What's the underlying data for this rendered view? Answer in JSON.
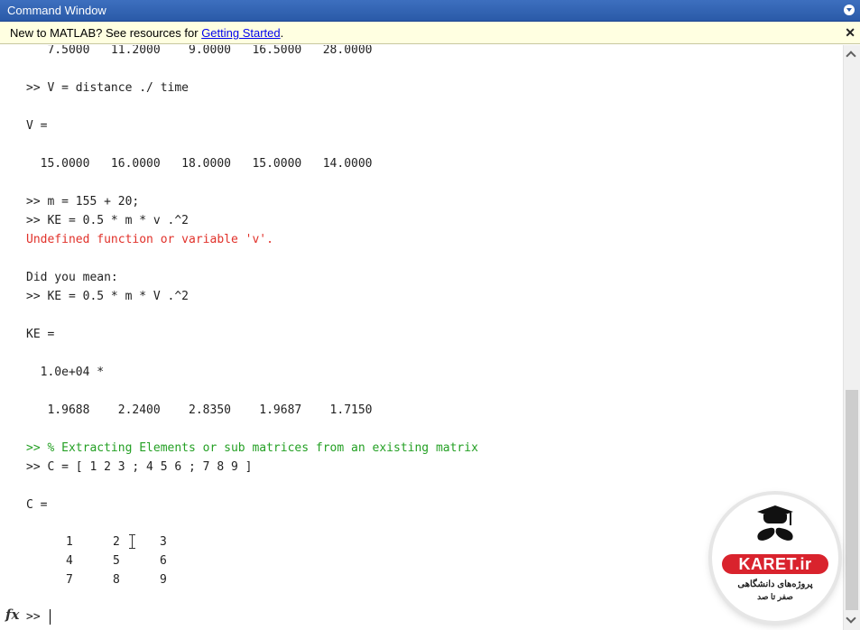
{
  "window": {
    "title": "Command Window"
  },
  "notice": {
    "text": "New to MATLAB? See resources for ",
    "link": "Getting Started",
    "suffix": "."
  },
  "console": {
    "lines": [
      "   7.5000   11.2000    9.0000   16.5000   28.0000",
      ">> V = distance ./ time",
      "V =",
      "  15.0000   16.0000   18.0000   15.0000   14.0000",
      ">> m = 155 + 20;",
      ">> KE = 0.5 * m * v .^2",
      "Undefined function or variable 'v'.",
      "Did you mean:",
      ">> KE = 0.5 * m * V .^2",
      "KE =",
      "  1.0e+04 *",
      "   1.9688    2.2400    2.8350    1.9687    1.7150",
      ">> % Extracting Elements or sub matrices from an existing matrix",
      ">> C = [ 1 2 3 ; 4 5 6 ; 7 8 9 ]",
      "C ="
    ],
    "matrix": [
      [
        "1",
        "2",
        "3"
      ],
      [
        "4",
        "5",
        "6"
      ],
      [
        "7",
        "8",
        "9"
      ]
    ],
    "prompt": ">>",
    "fx_label": "fx"
  },
  "logo": {
    "brand": "KARET.ir",
    "line1": "پروژه‌های دانشگاهی",
    "line2": "صفر تا صد"
  },
  "colors": {
    "title_bar": "#2a5aa8",
    "notice_bg": "#ffffe1",
    "error": "#e1312a",
    "comment": "#24a024"
  },
  "icons": {
    "title_menu": "chevron-down-circle-icon",
    "notice_close": "close-icon"
  }
}
